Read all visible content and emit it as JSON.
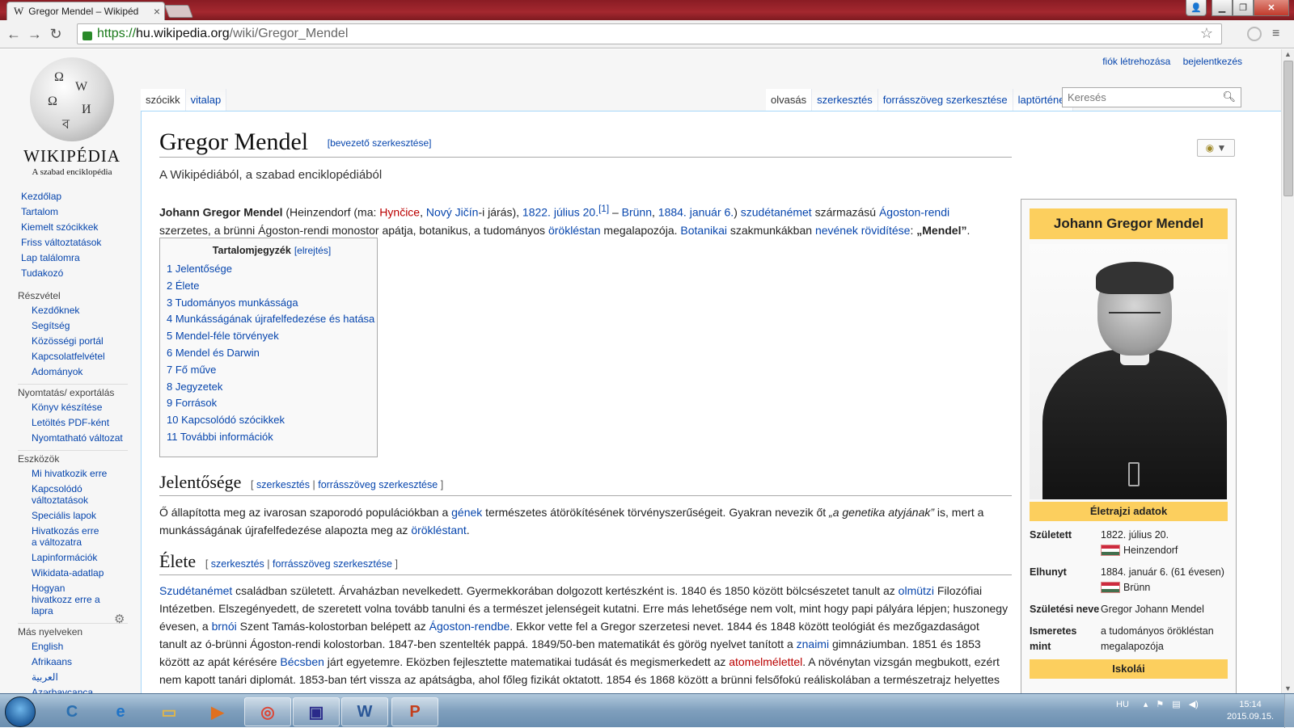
{
  "browser": {
    "tab_title": "Gregor Mendel – Wikipéd",
    "url_scheme": "https://",
    "url_host": "hu.wikipedia.org",
    "url_path": "/wiki/Gregor_Mendel"
  },
  "logo": {
    "wordmark": "WIKIPÉDIA",
    "tagline": "A szabad enciklopédia"
  },
  "sidebar": {
    "main": [
      "Kezdőlap",
      "Tartalom",
      "Kiemelt szócikkek",
      "Friss változtatások",
      "Lap találomra",
      "Tudakozó"
    ],
    "participation_title": "Részvétel",
    "participation": [
      "Kezdőknek",
      "Segítség",
      "Közösségi portál",
      "Kapcsolatfelvétel",
      "Adományok"
    ],
    "print_title": "Nyomtatás/ exportálás",
    "print": [
      "Könyv készítése",
      "Letöltés PDF-ként",
      "Nyomtatható változat"
    ],
    "tools_title": "Eszközök",
    "tools": [
      "Mi hivatkozik erre",
      "Kapcsolódó változtatások",
      "Speciális lapok",
      "Hivatkozás erre a változatra",
      "Lapinformációk",
      "Wikidata-adatlap",
      "Hogyan hivatkozz erre a lapra"
    ],
    "languages_title": "Más nyelveken",
    "languages": [
      "English",
      "Afrikaans",
      "العربية",
      "Azərbaycanca"
    ]
  },
  "personal": {
    "create_account": "fiók létrehozása",
    "login": "bejelentkezés"
  },
  "tabs": {
    "left": [
      "szócikk",
      "vitalap"
    ],
    "right": [
      "olvasás",
      "szerkesztés",
      "forrásszöveg szerkesztése",
      "laptörténet"
    ]
  },
  "search": {
    "placeholder": "Keresés"
  },
  "article": {
    "title": "Gregor Mendel",
    "title_edit": "[bevezető szerkesztése]",
    "site_sub": "A Wikipédiából, a szabad enciklopédiából",
    "lead": {
      "name": "Johann Gregor Mendel",
      "p1": " (Heinzendorf (ma: ",
      "l1": "Hynčice",
      "p2": ", ",
      "l2": "Nový Jičín",
      "p3": "-i járás), ",
      "l3": "1822. július 20.",
      "ref": "[1]",
      "p4": " – ",
      "l4": "Brünn",
      "p5": ", ",
      "l5": "1884. január 6.",
      "p6": ") ",
      "l6": "szudétanémet",
      "p7": " származású ",
      "l7": "Ágoston-rendi",
      "p8": " szerzetes, a brünni Ágoston-rendi monostor apátja, botanikus, a tudományos ",
      "l8": "örökléstan",
      "p9": " megalapozója. ",
      "l9": "Botanikai",
      "p10": " szakmunkákban ",
      "l10": "nevének rövidítése",
      "p11": ": ",
      "abbr": "„Mendel”",
      "p12": "."
    },
    "toc": {
      "title": "Tartalomjegyzék",
      "hide": "[elrejtés]",
      "items": [
        "1 Jelentősége",
        "2 Élete",
        "3 Tudományos munkássága",
        "4 Munkásságának újrafelfedezése és hatása",
        "5 Mendel-féle törvények",
        "6 Mendel és Darwin",
        "7 Fő műve",
        "8 Jegyzetek",
        "9 Források",
        "10 Kapcsolódó szócikkek",
        "11 További információk"
      ]
    },
    "sec1": {
      "title": "Jelentősége",
      "edit_open": "[",
      "edit": "szerkesztés",
      "sep": "|",
      "edit_src": "forrásszöveg szerkesztése",
      "edit_close": "]",
      "t1": "Ő állapította meg az ivarosan szaporodó populációkban a ",
      "l1": "gének",
      "t2": " természetes átörökítésének törvényszerűségeit. Gyakran nevezik őt ",
      "em": "„a genetika atyjának”",
      "t3": " is, mert a munkásságának újrafelfedezése alapozta meg az ",
      "l2": "örökléstant",
      "t4": "."
    },
    "sec2": {
      "title": "Élete",
      "edit_open": "[",
      "edit": "szerkesztés",
      "sep": "|",
      "edit_src": "forrásszöveg szerkesztése",
      "edit_close": "]",
      "l1": "Szudétanémet",
      "t1": " családban született. Árvaházban nevelkedett. Gyermekkorában dolgozott kertészként is. 1840 és 1850 között bölcsészetet tanult az ",
      "l2": "olmützi",
      "t2": " Filozófiai Intézetben. Elszegényedett, de szeretett volna tovább tanulni és a természet jelenségeit kutatni. Erre más lehetősége nem volt, mint hogy papi pályára lépjen; huszonegy évesen, a ",
      "l3": "brnói",
      "t3": " Szent Tamás-kolostorban belépett az ",
      "l4": "Ágoston-rendbe",
      "t4": ". Ekkor vette fel a Gregor szerzetesi nevet. 1844 és 1848 között teológiát és mezőgazdaságot tanult az ó-brünni Ágoston-rendi kolostorban. 1847-ben szentelték pappá. 1849/50-ben matematikát és görög nyelvet tanított a ",
      "l5": "znaimi",
      "t5": " gimnáziumban. 1851 és 1853 között az apát kérésére ",
      "l6": "Bécsben",
      "t6": " járt egyetemre. Eközben fejlesztette matematikai tudását és megismerkedett az ",
      "l7": "atomelmélettel",
      "t7": ". A növénytan vizsgán megbukott, ezért nem kapott tanári diplomát. 1853-ban tért vissza az apátságba, ahol főleg fizikát oktatott. 1854 és 1868 között a brünni felsőfokú reáliskolában a természetrajz helyettes"
    }
  },
  "infobox": {
    "title": "Johann Gregor Mendel",
    "section1": "Életrajzi adatok",
    "born_label": "Született",
    "born_date": "1822. július 20.",
    "born_place": "Heinzendorf",
    "died_label": "Elhunyt",
    "died_date": "1884. január 6. (61 évesen)",
    "died_place": "Brünn",
    "birthname_label": "Születési neve",
    "birthname": "Gregor Johann Mendel",
    "known_label": "Ismeretes mint",
    "known": "a tudományos örökléstan megalapozója",
    "section2": "Iskolái"
  },
  "taskbar": {
    "lang": "HU",
    "time": "15:14",
    "date": "2015.09.15."
  }
}
